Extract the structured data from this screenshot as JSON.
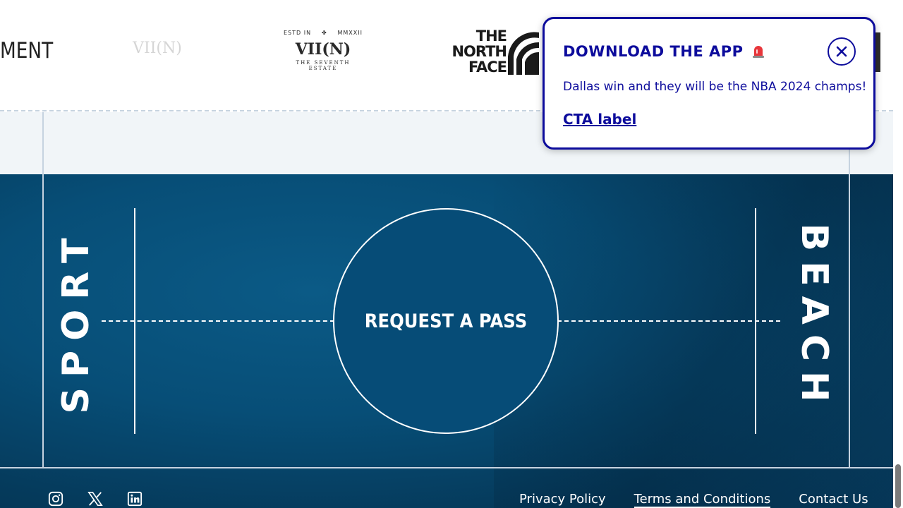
{
  "sponsors": {
    "partial_logo_text": "MENT",
    "viin": {
      "estd": "ESTD IN",
      "year": "MMXXII",
      "name": "VII(N)",
      "tagline": "THE SEVENTH ESTATE"
    },
    "north_face": {
      "name": "THE NORTH FACE"
    }
  },
  "court": {
    "left_word": "SPORT",
    "right_word": "BEACH",
    "cta_label": "REQUEST A PASS"
  },
  "footer": {
    "social": [
      "instagram-icon",
      "x-icon",
      "linkedin-icon"
    ],
    "links": [
      "Privacy Policy",
      "Terms and Conditions",
      "Contact Us"
    ]
  },
  "popup": {
    "title": "DOWNLOAD THE APP",
    "title_icon": "siren-icon",
    "message": "Dallas win and they will be the NBA 2024 champs!",
    "cta_label": "CTA label"
  },
  "colors": {
    "brand_navy": "#0d0c9c",
    "court_blue": "#064c77",
    "band_gray": "#f1f5f8"
  }
}
